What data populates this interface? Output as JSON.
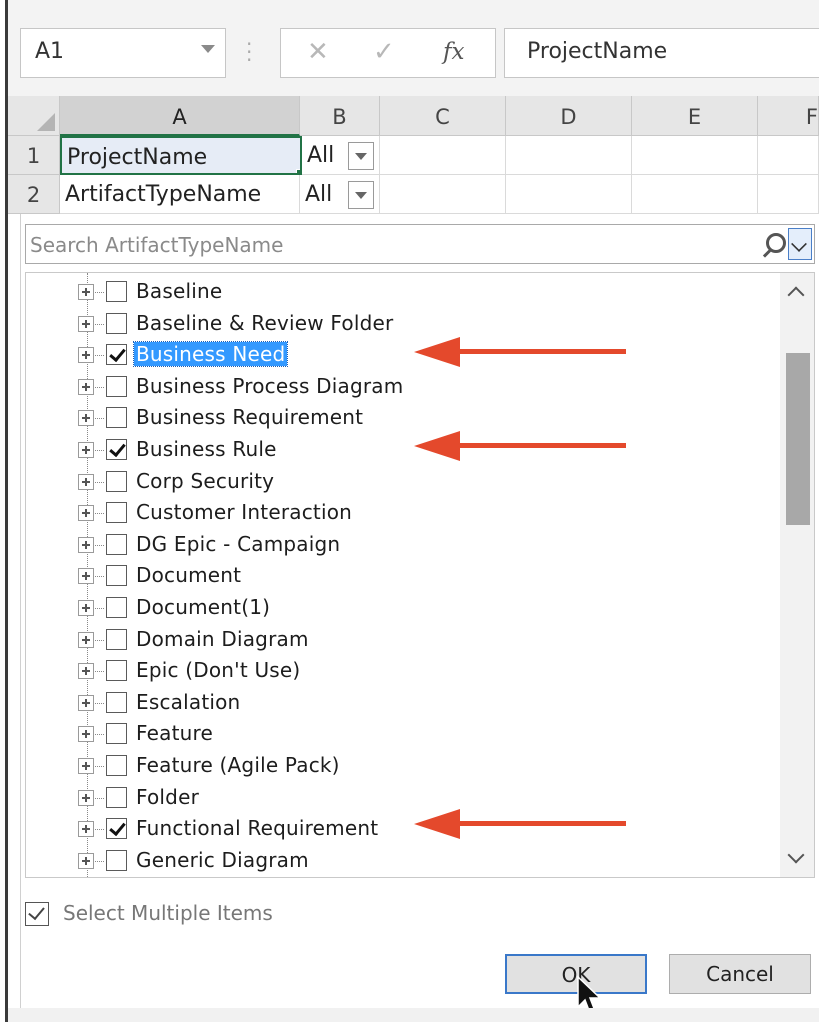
{
  "formula_bar": {
    "name_box": "A1",
    "formula": "ProjectName",
    "cancel_glyph": "✕",
    "enter_glyph": "✓",
    "fx_glyph": "fx"
  },
  "grid": {
    "columns": [
      "A",
      "B",
      "C",
      "D",
      "E",
      "F"
    ],
    "rows": [
      {
        "num": "1",
        "a": "ProjectName",
        "b": "All"
      },
      {
        "num": "2",
        "a": "ArtifactTypeName",
        "b": "All"
      }
    ]
  },
  "filter_panel": {
    "search_placeholder": "Search ArtifactTypeName",
    "items": [
      {
        "label": "Baseline",
        "checked": false,
        "selected": false
      },
      {
        "label": "Baseline & Review Folder",
        "checked": false,
        "selected": false
      },
      {
        "label": "Business Need",
        "checked": true,
        "selected": true
      },
      {
        "label": "Business Process Diagram",
        "checked": false,
        "selected": false
      },
      {
        "label": "Business Requirement",
        "checked": false,
        "selected": false
      },
      {
        "label": "Business Rule",
        "checked": true,
        "selected": false
      },
      {
        "label": "Corp Security",
        "checked": false,
        "selected": false
      },
      {
        "label": "Customer Interaction",
        "checked": false,
        "selected": false
      },
      {
        "label": "DG Epic - Campaign",
        "checked": false,
        "selected": false
      },
      {
        "label": "Document",
        "checked": false,
        "selected": false
      },
      {
        "label": "Document(1)",
        "checked": false,
        "selected": false
      },
      {
        "label": "Domain Diagram",
        "checked": false,
        "selected": false
      },
      {
        "label": "Epic (Don't Use)",
        "checked": false,
        "selected": false
      },
      {
        "label": "Escalation",
        "checked": false,
        "selected": false
      },
      {
        "label": "Feature",
        "checked": false,
        "selected": false
      },
      {
        "label": "Feature (Agile Pack)",
        "checked": false,
        "selected": false
      },
      {
        "label": "Folder",
        "checked": false,
        "selected": false
      },
      {
        "label": "Functional Requirement",
        "checked": true,
        "selected": false
      },
      {
        "label": "Generic Diagram",
        "checked": false,
        "selected": false
      }
    ],
    "select_multiple_label": "Select Multiple Items",
    "select_multiple_checked": true,
    "ok_label": "OK",
    "cancel_label": "Cancel"
  },
  "colors": {
    "accent_green": "#217346",
    "highlight_blue": "#3399ff",
    "annotation_arrow": "#e4492c"
  }
}
